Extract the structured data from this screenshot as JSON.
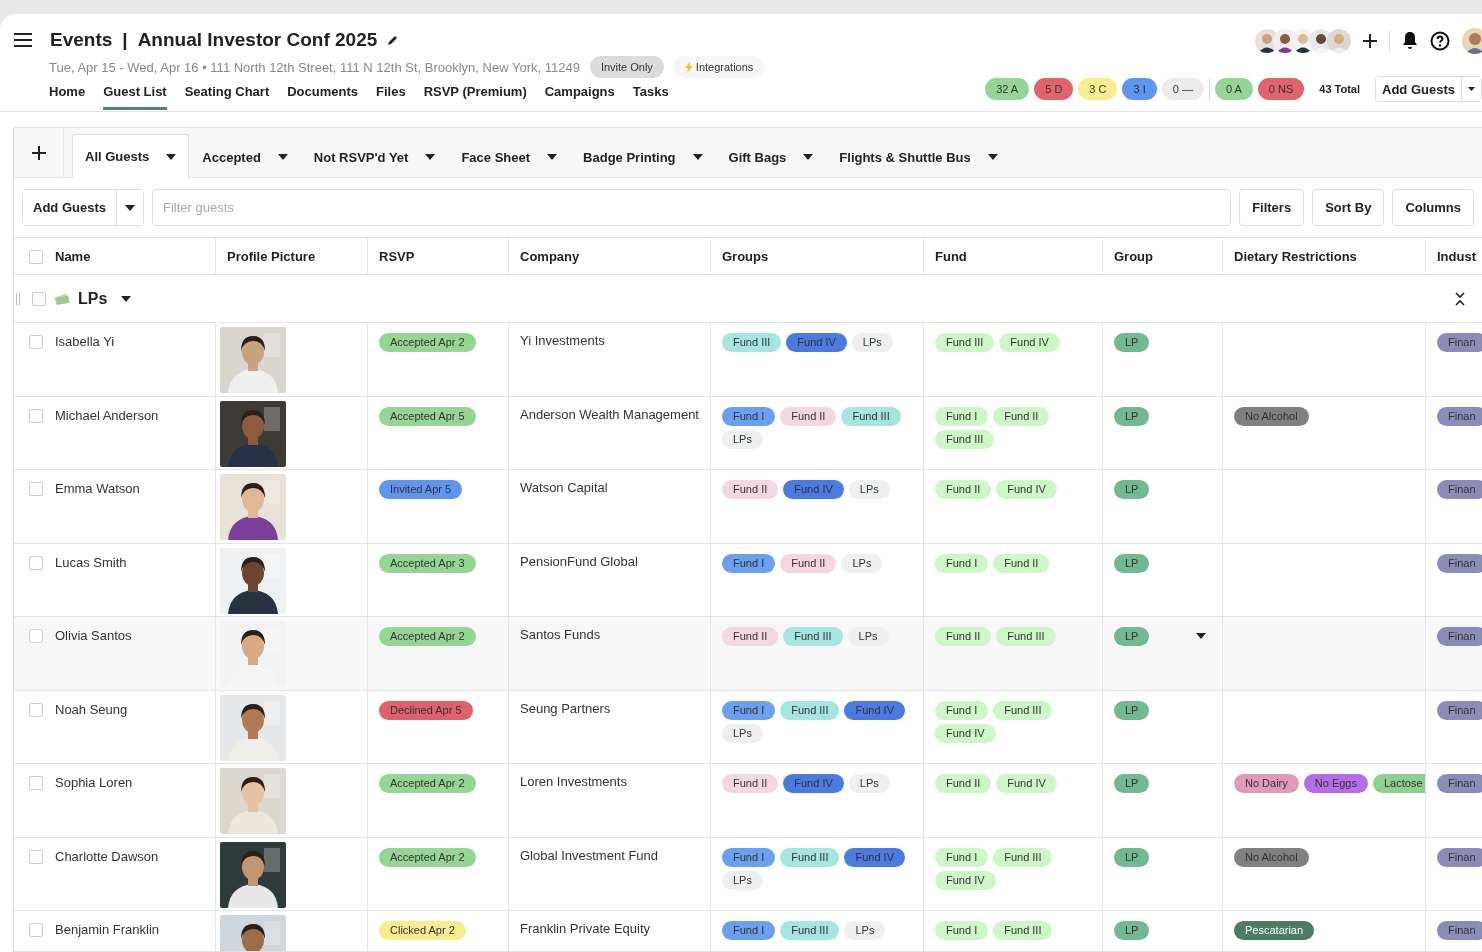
{
  "header": {
    "section": "Events",
    "separator": "|",
    "title": "Annual Investor Conf 2025",
    "subtitle": "Tue, Apr 15 - Wed, Apr 16 • 111 North 12th Street, 111 N 12th St, Brooklyn, New York, 11249",
    "badges": [
      {
        "label": "Invite Only",
        "kind": "access"
      },
      {
        "label": "Integrations",
        "kind": "integrations"
      }
    ]
  },
  "nav": [
    {
      "label": "Home",
      "selected": false
    },
    {
      "label": "Guest List",
      "selected": true
    },
    {
      "label": "Seating Chart",
      "selected": false
    },
    {
      "label": "Documents",
      "selected": false
    },
    {
      "label": "Files",
      "selected": false
    },
    {
      "label": "RSVP (Premium)",
      "selected": false
    },
    {
      "label": "Campaigns",
      "selected": false
    },
    {
      "label": "Tasks",
      "selected": false
    }
  ],
  "summary": {
    "chips": [
      {
        "label": "32 A",
        "color": "#95d695"
      },
      {
        "label": "5 D",
        "color": "#e0646c"
      },
      {
        "label": "3 C",
        "color": "#f8ee8e"
      },
      {
        "label": "3 I",
        "color": "#5e95ee"
      },
      {
        "label": "0 —",
        "color": "#ececec"
      },
      {
        "label": "0 A",
        "color": "#95d695"
      },
      {
        "label": "0 NS",
        "color": "#e0646c"
      }
    ],
    "total": "43 Total",
    "add_button": "Add Guests"
  },
  "views": [
    {
      "label": "All Guests",
      "selected": true
    },
    {
      "label": "Accepted",
      "selected": false
    },
    {
      "label": "Not RSVP'd Yet",
      "selected": false
    },
    {
      "label": "Face Sheet",
      "selected": false
    },
    {
      "label": "Badge Printing",
      "selected": false
    },
    {
      "label": "Gift Bags",
      "selected": false
    },
    {
      "label": "Flights & Shuttle Bus",
      "selected": false
    }
  ],
  "toolbar": {
    "add_button": "Add Guests",
    "filter": {
      "placeholder": "Filter guests"
    },
    "buttons": [
      "Filters",
      "Sort By",
      "Columns"
    ]
  },
  "table": {
    "columns": [
      "Name",
      "Profile Picture",
      "RSVP",
      "Company",
      "Groups",
      "Fund",
      "Group",
      "Dietary Restrictions",
      "Indust"
    ],
    "all_checked": false,
    "group": {
      "label": "LPs",
      "checked": false,
      "expanded": true
    },
    "rows": [
      {
        "name": "Isabella Yi",
        "checked": false,
        "hovered": false,
        "picture": {
          "kind": "picture"
        },
        "rsvp": {
          "label": "Accepted Apr 2",
          "color": "#95d695"
        },
        "company": "Yi Investments",
        "groups": [
          {
            "label": "Fund III",
            "color": "#a5e6df"
          },
          {
            "label": "Fund IV",
            "color": "#4b7be0"
          },
          {
            "label": "LPs",
            "color": "#eef0ef"
          }
        ],
        "fund": [
          {
            "label": "Fund III",
            "color": "#cdf7c6"
          },
          {
            "label": "Fund IV",
            "color": "#cdf7c6"
          }
        ],
        "group": {
          "label": "LP",
          "color": "#72b892"
        },
        "dietary": [],
        "industry": {
          "label": "Finan",
          "color": "#8c8cb8"
        }
      },
      {
        "name": "Michael Anderson",
        "checked": false,
        "hovered": false,
        "picture": {
          "kind": "picture"
        },
        "rsvp": {
          "label": "Accepted Apr 5",
          "color": "#95d695"
        },
        "company": "Anderson Wealth Management",
        "groups": [
          {
            "label": "Fund I",
            "color": "#6b9ff0"
          },
          {
            "label": "Fund II",
            "color": "#f5d7e1"
          },
          {
            "label": "Fund III",
            "color": "#a5e6df"
          },
          {
            "label": "LPs",
            "color": "#eef0ef"
          }
        ],
        "fund": [
          {
            "label": "Fund I",
            "color": "#cdf7c6"
          },
          {
            "label": "Fund II",
            "color": "#cdf7c6"
          },
          {
            "label": "Fund III",
            "color": "#cdf7c6"
          }
        ],
        "group": {
          "label": "LP",
          "color": "#72b892"
        },
        "dietary": [
          {
            "label": "No Alcohol",
            "color": "#808080"
          }
        ],
        "industry": {
          "label": "Finan",
          "color": "#8c8cb8"
        }
      },
      {
        "name": "Emma Watson",
        "checked": false,
        "hovered": false,
        "picture": {
          "kind": "picture"
        },
        "rsvp": {
          "label": "Invited Apr 5",
          "color": "#5e95ee"
        },
        "company": "Watson Capital",
        "groups": [
          {
            "label": "Fund II",
            "color": "#f5d7e1"
          },
          {
            "label": "Fund IV",
            "color": "#4b7be0"
          },
          {
            "label": "LPs",
            "color": "#eef0ef"
          }
        ],
        "fund": [
          {
            "label": "Fund II",
            "color": "#cdf7c6"
          },
          {
            "label": "Fund IV",
            "color": "#cdf7c6"
          }
        ],
        "group": {
          "label": "LP",
          "color": "#72b892"
        },
        "dietary": [],
        "industry": {
          "label": "Finan",
          "color": "#8c8cb8"
        }
      },
      {
        "name": "Lucas Smith",
        "checked": false,
        "hovered": false,
        "picture": {
          "kind": "picture"
        },
        "rsvp": {
          "label": "Accepted Apr 3",
          "color": "#95d695"
        },
        "company": "PensionFund Global",
        "groups": [
          {
            "label": "Fund I",
            "color": "#6b9ff0"
          },
          {
            "label": "Fund II",
            "color": "#f5d7e1"
          },
          {
            "label": "LPs",
            "color": "#eef0ef"
          }
        ],
        "fund": [
          {
            "label": "Fund I",
            "color": "#cdf7c6"
          },
          {
            "label": "Fund II",
            "color": "#cdf7c6"
          }
        ],
        "group": {
          "label": "LP",
          "color": "#72b892"
        },
        "dietary": [],
        "industry": {
          "label": "Finan",
          "color": "#8c8cb8"
        }
      },
      {
        "name": "Olivia Santos",
        "checked": false,
        "hovered": true,
        "picture": {
          "kind": "picture"
        },
        "rsvp": {
          "label": "Accepted Apr 2",
          "color": "#95d695"
        },
        "company": "Santos Funds",
        "groups": [
          {
            "label": "Fund II",
            "color": "#f5d7e1"
          },
          {
            "label": "Fund III",
            "color": "#a5e6df"
          },
          {
            "label": "LPs",
            "color": "#eef0ef"
          }
        ],
        "fund": [
          {
            "label": "Fund II",
            "color": "#cdf7c6"
          },
          {
            "label": "Fund III",
            "color": "#cdf7c6"
          }
        ],
        "group": {
          "label": "LP",
          "color": "#72b892"
        },
        "dietary": [],
        "industry": {
          "label": "Finan",
          "color": "#8c8cb8"
        }
      },
      {
        "name": "Noah Seung",
        "checked": false,
        "hovered": false,
        "picture": {
          "kind": "picture"
        },
        "rsvp": {
          "label": "Declined Apr 5",
          "color": "#e0606c"
        },
        "company": "Seung Partners",
        "groups": [
          {
            "label": "Fund I",
            "color": "#6b9ff0"
          },
          {
            "label": "Fund III",
            "color": "#a5e6df"
          },
          {
            "label": "Fund IV",
            "color": "#4b7be0"
          },
          {
            "label": "LPs",
            "color": "#eef0ef"
          }
        ],
        "fund": [
          {
            "label": "Fund I",
            "color": "#cdf7c6"
          },
          {
            "label": "Fund III",
            "color": "#cdf7c6"
          },
          {
            "label": "Fund IV",
            "color": "#cdf7c6"
          }
        ],
        "group": {
          "label": "LP",
          "color": "#72b892"
        },
        "dietary": [],
        "industry": {
          "label": "Finan",
          "color": "#8c8cb8"
        }
      },
      {
        "name": "Sophia Loren",
        "checked": false,
        "hovered": false,
        "picture": {
          "kind": "picture"
        },
        "rsvp": {
          "label": "Accepted Apr 2",
          "color": "#95d695"
        },
        "company": "Loren Investments",
        "groups": [
          {
            "label": "Fund II",
            "color": "#f5d7e1"
          },
          {
            "label": "Fund IV",
            "color": "#4b7be0"
          },
          {
            "label": "LPs",
            "color": "#eef0ef"
          }
        ],
        "fund": [
          {
            "label": "Fund II",
            "color": "#cdf7c6"
          },
          {
            "label": "Fund IV",
            "color": "#cdf7c6"
          }
        ],
        "group": {
          "label": "LP",
          "color": "#72b892"
        },
        "dietary": [
          {
            "label": "No Dairy",
            "color": "#e29ab9"
          },
          {
            "label": "No Eggs",
            "color": "#b56de8"
          },
          {
            "label": "Lactose",
            "color": "#8fcf8f"
          }
        ],
        "industry": {
          "label": "Finan",
          "color": "#8c8cb8"
        }
      },
      {
        "name": "Charlotte Dawson",
        "checked": false,
        "hovered": false,
        "picture": {
          "kind": "picture"
        },
        "rsvp": {
          "label": "Accepted Apr 2",
          "color": "#95d695"
        },
        "company": "Global Investment Fund",
        "groups": [
          {
            "label": "Fund I",
            "color": "#6b9ff0"
          },
          {
            "label": "Fund III",
            "color": "#a5e6df"
          },
          {
            "label": "Fund IV",
            "color": "#4b7be0"
          },
          {
            "label": "LPs",
            "color": "#eef0ef"
          }
        ],
        "fund": [
          {
            "label": "Fund I",
            "color": "#cdf7c6"
          },
          {
            "label": "Fund III",
            "color": "#cdf7c6"
          },
          {
            "label": "Fund IV",
            "color": "#cdf7c6"
          }
        ],
        "group": {
          "label": "LP",
          "color": "#72b892"
        },
        "dietary": [
          {
            "label": "No Alcohol",
            "color": "#808080"
          }
        ],
        "industry": {
          "label": "Finan",
          "color": "#8c8cb8"
        }
      },
      {
        "name": "Benjamin Franklin",
        "checked": false,
        "hovered": false,
        "picture": {
          "kind": "picture"
        },
        "rsvp": {
          "label": "Clicked Apr 2",
          "color": "#f8ec90"
        },
        "company": "Franklin Private Equity",
        "groups": [
          {
            "label": "Fund I",
            "color": "#6b9ff0"
          },
          {
            "label": "Fund III",
            "color": "#a5e6df"
          },
          {
            "label": "LPs",
            "color": "#eef0ef"
          }
        ],
        "fund": [
          {
            "label": "Fund I",
            "color": "#cdf7c6"
          },
          {
            "label": "Fund III",
            "color": "#cdf7c6"
          }
        ],
        "group": {
          "label": "LP",
          "color": "#72b892"
        },
        "dietary": [
          {
            "label": "Pescatarian",
            "color": "#4a7c66"
          }
        ],
        "industry": {
          "label": "Finan",
          "color": "#8c8cb8"
        }
      }
    ]
  }
}
